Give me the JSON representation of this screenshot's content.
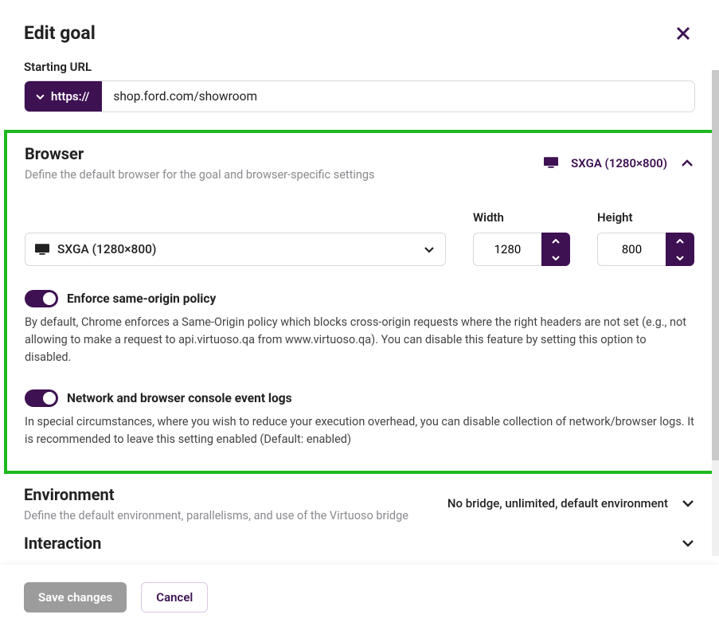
{
  "header": {
    "title": "Edit goal"
  },
  "url": {
    "label": "Starting URL",
    "protocol": "https://",
    "value": "shop.ford.com/showroom"
  },
  "sections": {
    "browser": {
      "title": "Browser",
      "subtitle": "Define the default browser for the goal and browser-specific settings",
      "summary": "SXGA (1280×800)",
      "select_value": "SXGA (1280×800)",
      "width_label": "Width",
      "width_value": "1280",
      "height_label": "Height",
      "height_value": "800",
      "toggles": {
        "same_origin": {
          "label": "Enforce same-origin policy",
          "desc": "By default, Chrome enforces a Same-Origin policy which blocks cross-origin requests where the right headers are not set (e.g., not allowing to make a request to api.virtuoso.qa from www.virtuoso.qa). You can disable this feature by setting this option to disabled.",
          "enabled": true
        },
        "logs": {
          "label": "Network and browser console event logs",
          "desc": "In special circumstances, where you wish to reduce your execution overhead, you can disable collection of network/browser logs. It is recommended to leave this setting enabled (Default: enabled)",
          "enabled": true
        }
      }
    },
    "environment": {
      "title": "Environment",
      "subtitle": "Define the default environment, parallelisms, and use of the Virtuoso bridge",
      "summary": "No bridge, unlimited, default environment"
    },
    "interaction": {
      "title": "Interaction"
    }
  },
  "footer": {
    "save": "Save changes",
    "cancel": "Cancel"
  }
}
